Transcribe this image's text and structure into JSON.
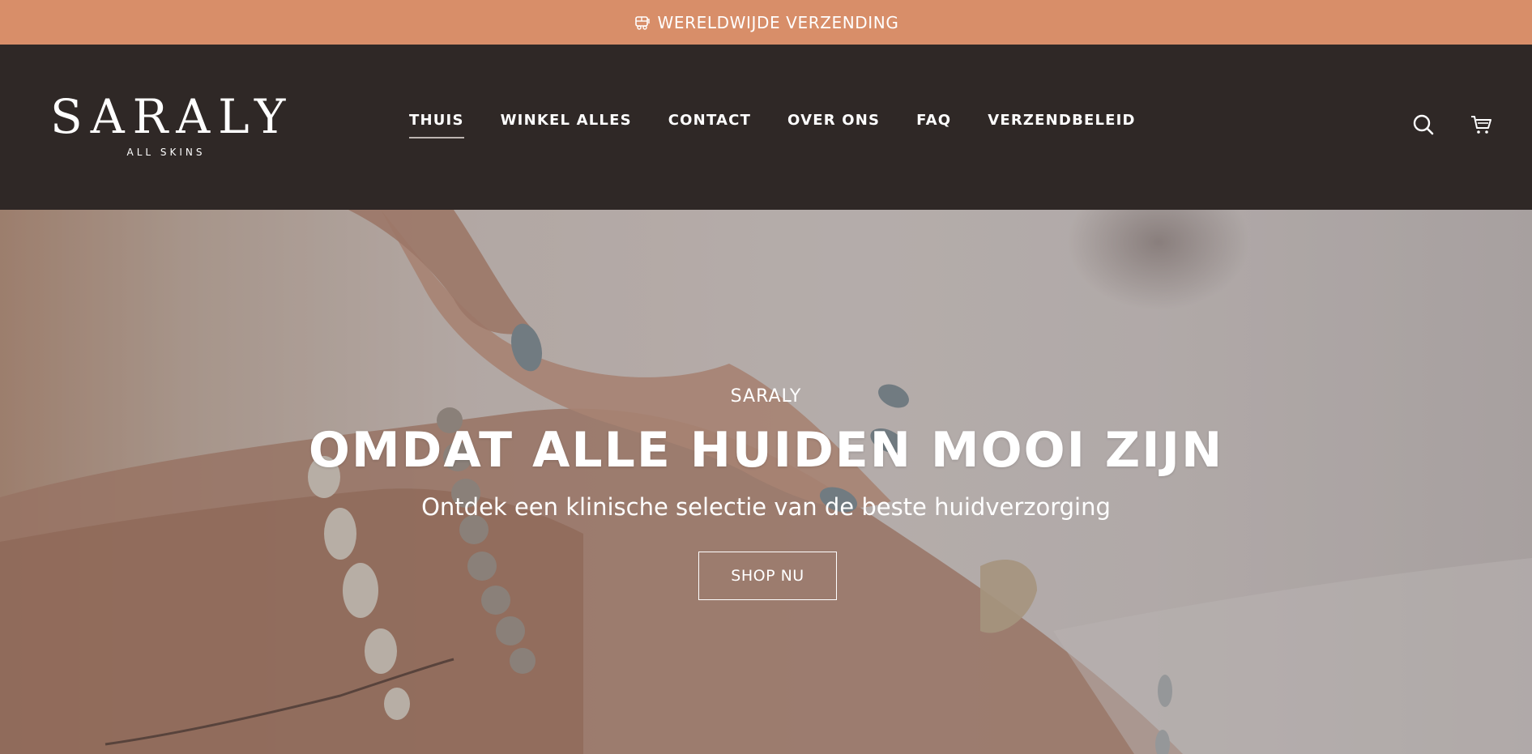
{
  "colors": {
    "announcement_bg": "#d88e69",
    "header_bg": "#2f2826",
    "text": "#ffffff",
    "nav_active_underline": "#bdb5b1"
  },
  "announcement": {
    "icon": "truck-icon",
    "text": "WERELDWIJDE VERZENDING"
  },
  "logo": {
    "wordmark": "SARALY",
    "tagline": "ALL SKINS"
  },
  "nav": {
    "items": [
      {
        "label": "THUIS",
        "active": true
      },
      {
        "label": "WINKEL ALLES",
        "active": false
      },
      {
        "label": "CONTACT",
        "active": false
      },
      {
        "label": "OVER ONS",
        "active": false
      },
      {
        "label": "FAQ",
        "active": false
      },
      {
        "label": "VERZENDBELEID",
        "active": false
      }
    ]
  },
  "header_icons": {
    "search": "search-icon",
    "cart": "cart-icon"
  },
  "hero": {
    "eyebrow": "SARALY",
    "title": "OMDAT ALLE HUIDEN MOOI ZIJN",
    "subtitle": "Ontdek een klinische selectie van de beste huidverzorging",
    "button_label": "SHOP NU"
  }
}
